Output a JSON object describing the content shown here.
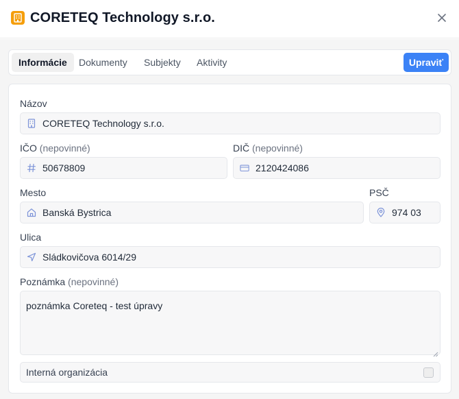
{
  "dialog": {
    "title": "CORETEQ Technology s.r.o.",
    "logo_icon": "building-icon",
    "close_icon": "close-icon",
    "accent_color": "#f59e0b"
  },
  "tabs": [
    {
      "label": "Informácie",
      "active": true
    },
    {
      "label": "Dokumenty",
      "active": false
    },
    {
      "label": "Subjekty",
      "active": false
    },
    {
      "label": "Aktivity",
      "active": false
    }
  ],
  "actions": {
    "edit_label": "Upraviť",
    "edit_color": "#3b82f6"
  },
  "form": {
    "name": {
      "label": "Názov",
      "value": "CORETEQ Technology s.r.o.",
      "icon": "building-icon"
    },
    "ico": {
      "label": "IČO",
      "optional": "(nepovinné)",
      "value": "50678809",
      "icon": "hash-icon"
    },
    "dic": {
      "label": "DIČ",
      "optional": "(nepovinné)",
      "value": "2120424086",
      "icon": "card-icon"
    },
    "city": {
      "label": "Mesto",
      "value": "Banská Bystrica",
      "icon": "home-icon"
    },
    "zip": {
      "label": "PSČ",
      "value": "974 03",
      "icon": "map-pin-icon"
    },
    "street": {
      "label": "Ulica",
      "value": "Sládkovičova 6014/29",
      "icon": "navigation-icon"
    },
    "note": {
      "label": "Poznámka",
      "optional": "(nepovinné)",
      "value": "poznámka Coreteq - test úpravy"
    },
    "internal": {
      "label": "Interná organizácia",
      "checked": false
    }
  }
}
